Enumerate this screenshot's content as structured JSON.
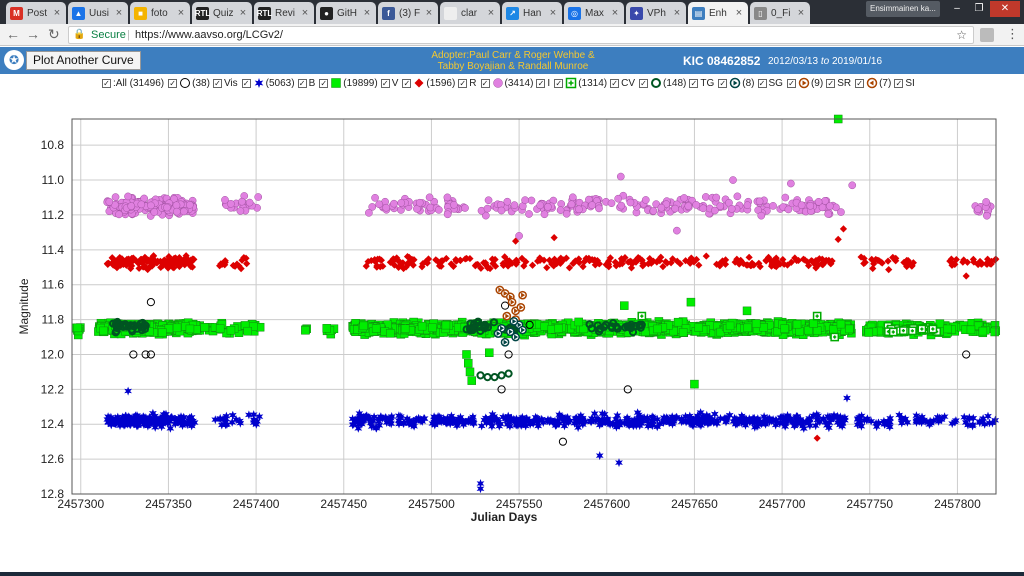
{
  "browser": {
    "tabs": [
      {
        "label": "Post",
        "icon": "gmail-icon",
        "color": "#d93025",
        "glyph": "M"
      },
      {
        "label": "Uusi",
        "icon": "drive-icon",
        "color": "#1a73e8",
        "glyph": "▲"
      },
      {
        "label": "foto",
        "icon": "folder-icon",
        "color": "#f4b400",
        "glyph": "■"
      },
      {
        "label": "Quiz",
        "icon": "rtl-icon",
        "color": "#222222",
        "glyph": "RTL"
      },
      {
        "label": "Revi",
        "icon": "rtl-icon",
        "color": "#222222",
        "glyph": "RTL"
      },
      {
        "label": "GitH",
        "icon": "github-icon",
        "color": "#222222",
        "glyph": "●"
      },
      {
        "label": "(3) F",
        "icon": "facebook-icon",
        "color": "#3b5998",
        "glyph": "f"
      },
      {
        "label": "clar",
        "icon": "blank-icon",
        "color": "#eeeeee",
        "glyph": ""
      },
      {
        "label": "Han",
        "icon": "chart-icon",
        "color": "#1e88e5",
        "glyph": "↗"
      },
      {
        "label": "Max",
        "icon": "globe-icon",
        "color": "#1a73e8",
        "glyph": "◎"
      },
      {
        "label": "VPh",
        "icon": "star-icon",
        "color": "#3949ab",
        "glyph": "✦"
      },
      {
        "label": "Enh",
        "icon": "page-icon",
        "color": "#3d7ebf",
        "glyph": "▤",
        "active": true
      },
      {
        "label": "0_Fi",
        "icon": "document-icon",
        "color": "#888888",
        "glyph": "▯"
      }
    ],
    "profile": "Ensimmainen ka...",
    "secure_label": "Secure",
    "url": "https://www.aavso.org/LCGv2/"
  },
  "header": {
    "button_label": "Plot Another Curve",
    "adopter_line1": "Adopter:Paul Carr & Roger Wehbe &",
    "adopter_line2": "Tabby Boyajian & Randall Munroe",
    "star_name": "KIC 08462852",
    "date_from": "2012/03/13",
    "date_to_word": "to",
    "date_to": "2019/01/16"
  },
  "legend": [
    {
      "key": "all",
      "label": "All (31496)",
      "marker": "none",
      "color": "#000000"
    },
    {
      "key": "vis",
      "label": "(38)",
      "suffix": "Vis",
      "marker": "open-circle",
      "color": "#000000"
    },
    {
      "key": "b",
      "label": "(5063)",
      "suffix": "B",
      "marker": "star",
      "color": "#0000cc"
    },
    {
      "key": "v",
      "label": "(19899)",
      "suffix": "V",
      "marker": "square",
      "color": "#00ee00"
    },
    {
      "key": "r",
      "label": "(1596)",
      "suffix": "R",
      "marker": "diamond",
      "color": "#dd0000"
    },
    {
      "key": "i",
      "label": "(3414)",
      "suffix": "I",
      "marker": "circle",
      "color": "#e080e0"
    },
    {
      "key": "cv",
      "label": "(1314)",
      "suffix": "CV",
      "marker": "cross-square",
      "color": "#00aa00"
    },
    {
      "key": "tg",
      "label": "(148)",
      "suffix": "TG",
      "marker": "ring",
      "color": "#005522"
    },
    {
      "key": "sg",
      "label": "(8)",
      "suffix": "SG",
      "marker": "triangle-circle",
      "color": "#004444"
    },
    {
      "key": "sr",
      "label": "(9)",
      "suffix": "SR",
      "marker": "triangle-circle",
      "color": "#aa4400"
    },
    {
      "key": "si",
      "label": "(7)",
      "suffix": "SI",
      "marker": "left-circle",
      "color": "#aa4400"
    }
  ],
  "chart_data": {
    "type": "scatter",
    "xlabel": "Julian Days",
    "ylabel": "Magnitude",
    "xlim": [
      2457295,
      2457822
    ],
    "ylim": [
      12.8,
      10.65
    ],
    "y_inverted": true,
    "grid": true,
    "x_ticks": [
      2457300,
      2457350,
      2457400,
      2457450,
      2457500,
      2457550,
      2457600,
      2457650,
      2457700,
      2457750,
      2457800
    ],
    "y_ticks": [
      10.8,
      11.0,
      11.2,
      11.4,
      11.6,
      11.8,
      12.0,
      12.2,
      12.4,
      12.6,
      12.8
    ],
    "colors": {
      "V": "#00ee00",
      "B": "#0000cc",
      "R": "#dd0000",
      "I": "#e080e0",
      "CV": "#00aa00",
      "TG": "#005522",
      "SG": "#004444",
      "SR": "#aa4400",
      "Vis": "#000000"
    },
    "series": [
      {
        "name": "I",
        "marker": "circle",
        "mean": 11.15,
        "spread": 0.07,
        "segments": [
          [
            2457315,
            2457365,
            4
          ],
          [
            2457382,
            2457403,
            1
          ],
          [
            2457462,
            2457735,
            1
          ],
          [
            2457810,
            2457822,
            1
          ]
        ],
        "outliers": [
          [
            2457608,
            10.98
          ],
          [
            2457705,
            11.02
          ],
          [
            2457740,
            11.03
          ],
          [
            2457550,
            11.32
          ],
          [
            2457640,
            11.29
          ],
          [
            2457672,
            11.0
          ]
        ]
      },
      {
        "name": "R",
        "marker": "diamond",
        "mean": 11.47,
        "spread": 0.05,
        "segments": [
          [
            2457315,
            2457365,
            3
          ],
          [
            2457378,
            2457395,
            1
          ],
          [
            2457462,
            2457735,
            1
          ],
          [
            2457745,
            2457775,
            1
          ],
          [
            2457795,
            2457822,
            1
          ]
        ],
        "outliers": [
          [
            2457735,
            11.28
          ],
          [
            2457732,
            11.34
          ],
          [
            2457570,
            11.33
          ],
          [
            2457548,
            11.35
          ],
          [
            2457720,
            12.48
          ],
          [
            2457805,
            11.55
          ]
        ]
      },
      {
        "name": "V",
        "marker": "square",
        "mean": 11.85,
        "spread": 0.045,
        "segments": [
          [
            2457297,
            2457300,
            3
          ],
          [
            2457310,
            2457368,
            5
          ],
          [
            2457370,
            2457403,
            1
          ],
          [
            2457427,
            2457429,
            1
          ],
          [
            2457440,
            2457445,
            1
          ],
          [
            2457455,
            2457740,
            5
          ],
          [
            2457748,
            2457822,
            2
          ]
        ],
        "outliers": [
          [
            2457732,
            10.65
          ],
          [
            2457523,
            12.15
          ],
          [
            2457522,
            12.1
          ],
          [
            2457521,
            12.05
          ],
          [
            2457520,
            12.0
          ],
          [
            2457533,
            11.99
          ],
          [
            2457650,
            12.17
          ],
          [
            2457648,
            11.7
          ],
          [
            2457610,
            11.72
          ],
          [
            2457680,
            11.75
          ]
        ]
      },
      {
        "name": "B",
        "marker": "star",
        "mean": 12.38,
        "spread": 0.05,
        "segments": [
          [
            2457315,
            2457365,
            4
          ],
          [
            2457376,
            2457402,
            1
          ],
          [
            2457455,
            2457738,
            2
          ],
          [
            2457742,
            2457822,
            1
          ]
        ],
        "outliers": [
          [
            2457528,
            12.77
          ],
          [
            2457528,
            12.74
          ],
          [
            2457607,
            12.62
          ],
          [
            2457596,
            12.58
          ],
          [
            2457737,
            12.25
          ],
          [
            2457327,
            12.21
          ]
        ]
      },
      {
        "name": "TG",
        "marker": "ring",
        "mean": 11.84,
        "spread": 0.04,
        "segments": [
          [
            2457318,
            2457338,
            2
          ],
          [
            2457520,
            2457550,
            1
          ],
          [
            2457590,
            2457620,
            1
          ]
        ],
        "outliers": [
          [
            2457528,
            12.12
          ],
          [
            2457532,
            12.13
          ],
          [
            2457536,
            12.13
          ],
          [
            2457540,
            12.12
          ],
          [
            2457544,
            12.11
          ]
        ]
      },
      {
        "name": "Vis",
        "marker": "open-circle",
        "mean": 11.85,
        "spread": 0.0,
        "segments": [],
        "outliers": [
          [
            2457340,
            11.7
          ],
          [
            2457330,
            12.0
          ],
          [
            2457337,
            12.0
          ],
          [
            2457340,
            12.0
          ],
          [
            2457540,
            12.2
          ],
          [
            2457544,
            12.0
          ],
          [
            2457575,
            12.5
          ],
          [
            2457612,
            12.2
          ],
          [
            2457805,
            12.0
          ],
          [
            2457542,
            11.72
          ],
          [
            2457556,
            11.83
          ]
        ]
      },
      {
        "name": "CV",
        "marker": "cross-square",
        "mean": 11.86,
        "spread": 0.03,
        "segments": [
          [
            2457760,
            2457790,
            1
          ]
        ],
        "outliers": [
          [
            2457620,
            11.78
          ],
          [
            2457720,
            11.78
          ],
          [
            2457730,
            11.9
          ]
        ]
      },
      {
        "name": "SR",
        "marker": "triangle-circle",
        "mean": 11.7,
        "spread": 0.0,
        "segments": [],
        "outliers": [
          [
            2457539,
            11.63
          ],
          [
            2457542,
            11.65
          ],
          [
            2457545,
            11.67
          ],
          [
            2457548,
            11.75
          ],
          [
            2457551,
            11.73
          ],
          [
            2457546,
            11.7
          ],
          [
            2457552,
            11.66
          ],
          [
            2457543,
            11.78
          ],
          [
            2457548,
            11.8
          ]
        ]
      },
      {
        "name": "SG",
        "marker": "triangle-circle",
        "mean": 11.85,
        "spread": 0.0,
        "segments": [],
        "outliers": [
          [
            2457540,
            11.85
          ],
          [
            2457545,
            11.87
          ],
          [
            2457550,
            11.83
          ],
          [
            2457548,
            11.9
          ],
          [
            2457538,
            11.88
          ],
          [
            2457542,
            11.93
          ],
          [
            2457547,
            11.81
          ],
          [
            2457552,
            11.86
          ]
        ]
      }
    ]
  }
}
